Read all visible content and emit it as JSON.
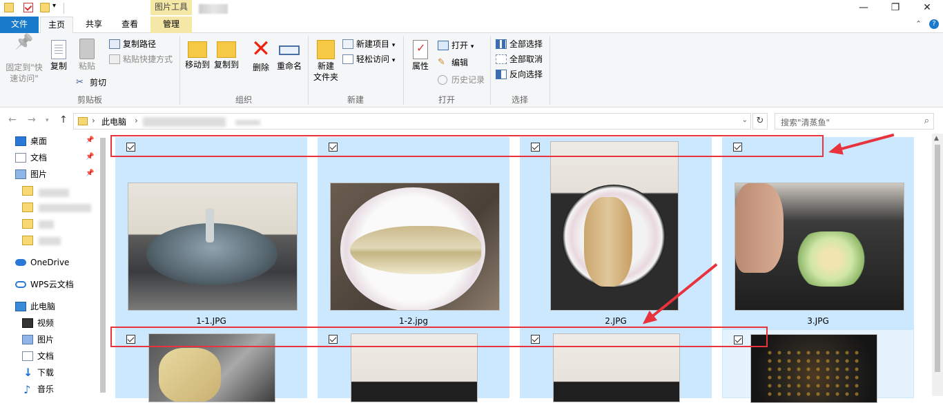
{
  "titlebar": {
    "context_tab": "图片工具",
    "window_controls": {
      "minimize": "—",
      "maximize": "❐",
      "close": "✕"
    }
  },
  "tabs": {
    "file": "文件",
    "home": "主页",
    "share": "共享",
    "view": "查看",
    "manage": "管理"
  },
  "ribbon": {
    "clipboard": {
      "label": "剪贴板",
      "pin": "固定到\"快\n速访问\"",
      "copy": "复制",
      "paste": "粘贴",
      "copy_path": "复制路径",
      "paste_shortcut": "粘贴快捷方式",
      "cut": "剪切"
    },
    "organize": {
      "label": "组织",
      "move_to": "移动到",
      "copy_to": "复制到",
      "delete": "删除",
      "rename": "重命名"
    },
    "new": {
      "label": "新建",
      "new_folder": "新建\n文件夹",
      "new_item": "新建项目",
      "easy_access": "轻松访问"
    },
    "open": {
      "label": "打开",
      "properties": "属性",
      "open": "打开",
      "edit": "编辑",
      "history": "历史记录"
    },
    "select": {
      "label": "选择",
      "select_all": "全部选择",
      "select_none": "全部取消",
      "invert": "反向选择"
    }
  },
  "address": {
    "crumb_root": "此电脑",
    "search_placeholder": "搜索\"清蒸鱼\""
  },
  "navpane": {
    "quick": [
      {
        "label": "桌面",
        "icon": "desktop-icon"
      },
      {
        "label": "文档",
        "icon": "documents-icon"
      },
      {
        "label": "图片",
        "icon": "pictures-icon"
      }
    ],
    "onedrive": "OneDrive",
    "wps": "WPS云文档",
    "thispc": "此电脑",
    "pc_items": [
      "视频",
      "图片",
      "文档",
      "下载",
      "音乐"
    ]
  },
  "files": [
    {
      "name": "1-1.JPG",
      "checked": true,
      "selected": true
    },
    {
      "name": "1-2.jpg",
      "checked": true,
      "selected": true
    },
    {
      "name": "2.JPG",
      "checked": true,
      "selected": true
    },
    {
      "name": "3.JPG",
      "checked": true,
      "selected": true
    },
    {
      "name": "",
      "checked": true,
      "selected": true
    },
    {
      "name": "",
      "checked": true,
      "selected": true
    },
    {
      "name": "",
      "checked": true,
      "selected": true
    },
    {
      "name": "",
      "checked": true,
      "selected": false
    }
  ],
  "colors": {
    "accent": "#1979ca",
    "selection": "#cce8ff",
    "annotation": "#e8323c",
    "context_tab": "#f5e8a6"
  }
}
